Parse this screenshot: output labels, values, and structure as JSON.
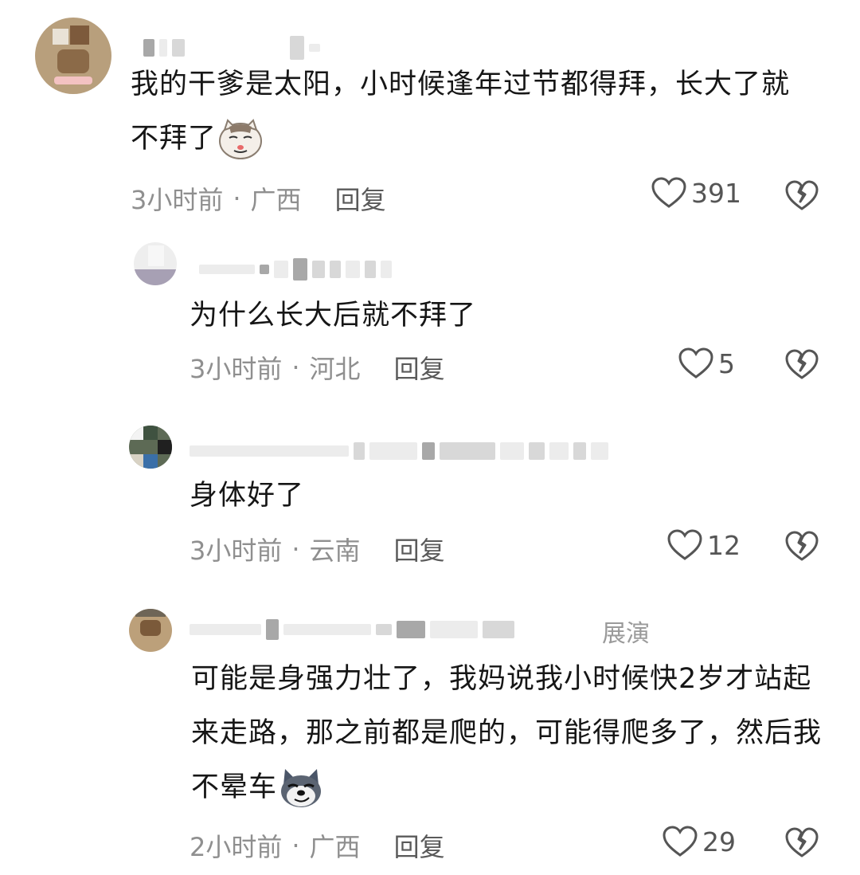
{
  "comments": [
    {
      "text": "我的干爹是太阳，小时候逢年过节都得拜，长大了就不拜了",
      "emoji": "smug-cat-emoji",
      "time": "3小时前",
      "location": "广西",
      "reply_label": "回复",
      "likes": "391"
    },
    {
      "text": "为什么长大后就不拜了",
      "time": "3小时前",
      "location": "河北",
      "reply_label": "回复",
      "likes": "5"
    },
    {
      "text": "身体好了",
      "time": "3小时前",
      "location": "云南",
      "reply_label": "回复",
      "likes": "12"
    },
    {
      "name_fragment": "展演",
      "text": "可能是身强力壮了，我妈说我小时候快2岁才站起来走路，那之前都是爬的，可能得爬多了，然后我不晕车",
      "emoji": "smirking-dog-emoji",
      "time": "2小时前",
      "location": "广西",
      "reply_label": "回复",
      "likes": "29"
    }
  ],
  "separator": "·",
  "colors": {
    "text": "#161616",
    "meta": "#8f8f8f",
    "icon": "#555555"
  }
}
